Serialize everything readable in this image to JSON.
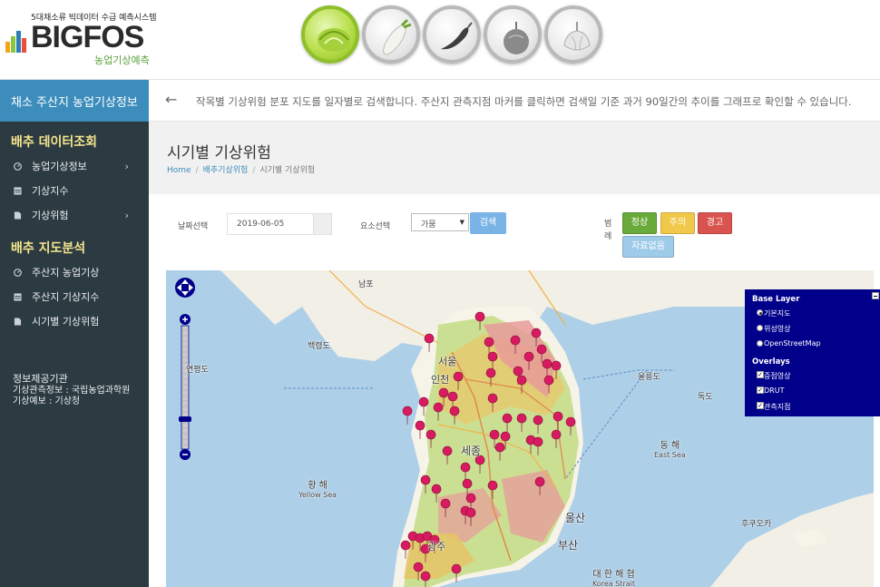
{
  "header": {
    "logo_tagline": "5대채소류 빅데이터 수급 예측시스템",
    "logo_brand": "BIGFOS",
    "logo_sub": "농업기상예측",
    "crops": [
      {
        "name": "cabbage",
        "active": true
      },
      {
        "name": "radish",
        "active": false
      },
      {
        "name": "pepper",
        "active": false
      },
      {
        "name": "onion",
        "active": false
      },
      {
        "name": "garlic",
        "active": false
      }
    ]
  },
  "sidebar": {
    "header": "채소 주산지 농업기상정보",
    "section1_title": "배추 데이터조회",
    "section1_items": [
      "농업기상정보",
      "기상지수",
      "기상위험"
    ],
    "section2_title": "배추 지도분석",
    "section2_items": [
      "주산지 농업기상",
      "주산지 기상지수",
      "시기별 기상위험"
    ],
    "provider_title": "정보제공기관",
    "provider_lines": [
      "기상관측정보 : 국립농업과학원",
      "기상예보 : 기상청"
    ]
  },
  "info": {
    "text": "작목별 기상위험 분포 지도를 일자별로 검색합니다. 주산지 관측지점 마커를 클릭하면 검색일 기준 과거 90일간의 추이를 그래프로 확인할 수 있습니다."
  },
  "page": {
    "title": "시기별 기상위험",
    "breadcrumb": [
      "Home",
      "배추기상위험",
      "시기별 기상위험"
    ]
  },
  "filters": {
    "date_label": "날짜선택",
    "date_value": "2019-06-05",
    "element_label": "요소선택",
    "element_value": "가뭄",
    "search_label": "검색",
    "legend_label": "범례",
    "legend": [
      {
        "label": "정상",
        "color": "#6aaa3a"
      },
      {
        "label": "주의",
        "color": "#f0c84a"
      },
      {
        "label": "경고",
        "color": "#d9534f"
      },
      {
        "label": "자료없음",
        "color": "#9ecbe8"
      }
    ]
  },
  "map": {
    "layer_panel": {
      "base_title": "Base Layer",
      "base_options": [
        "기본지도",
        "위성영상",
        "OpenStreetMap"
      ],
      "base_selected": "기본지도",
      "overlay_title": "Overlays",
      "overlays": [
        "증점영상",
        "DRUT",
        "관측지점"
      ]
    },
    "labels": {
      "nampo": "남포",
      "pyongyang_area": "황해",
      "seoul": "서울",
      "incheon": "인천",
      "sejong": "세종",
      "ulsan": "울산",
      "busan": "부산",
      "gwangju": "광주",
      "baengnyeong": "백령도",
      "yeonpyeong": "연평도",
      "ulleung": "울릉도",
      "dokdo": "독도",
      "fukuoka": "후쿠오카"
    },
    "seas": [
      {
        "ko": "동 해",
        "en": "East Sea"
      },
      {
        "ko": "황 해",
        "en": "Yellow Sea"
      },
      {
        "ko": "대 한 해 협",
        "en": "Korea Strait"
      }
    ]
  }
}
